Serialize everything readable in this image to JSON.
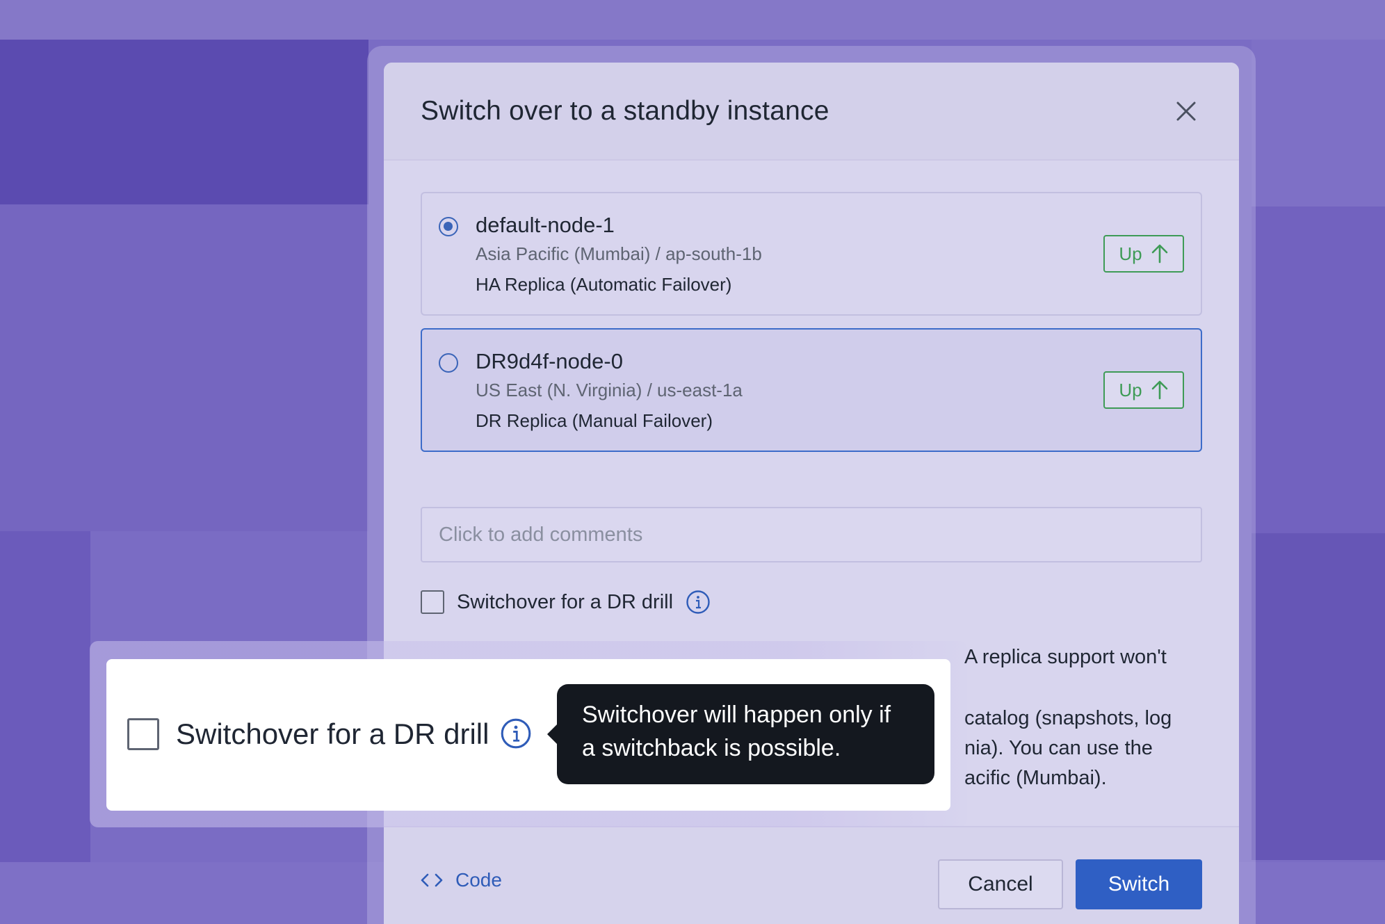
{
  "dialog": {
    "title": "Switch over to a standby instance",
    "close_icon": "close-icon"
  },
  "nodes": [
    {
      "name": "default-node-1",
      "region": "Asia Pacific (Mumbai) / ap-south-1b",
      "role": "HA Replica  (Automatic Failover)",
      "status": "Up",
      "selected": true
    },
    {
      "name": "DR9d4f-node-0",
      "region": "US East (N. Virginia) / us-east-1a",
      "role": "DR Replica (Manual Failover)",
      "status": "Up",
      "selected": false
    }
  ],
  "comments": {
    "placeholder": "Click to add comments",
    "value": ""
  },
  "drill": {
    "label": "Switchover for a DR drill",
    "checked": false
  },
  "description": {
    "line1": "A replica support won't",
    "line2": "catalog (snapshots, log",
    "line3": "nia). You can use the",
    "line4": "acific (Mumbai)."
  },
  "footer": {
    "code_label": "Code",
    "cancel_label": "Cancel",
    "switch_label": "Switch"
  },
  "callout": {
    "label": "Switchover for a DR drill",
    "tooltip_line1": "Switchover will happen only if",
    "tooltip_line2": "a switchback is possible."
  },
  "colors": {
    "primary": "#2f5fc4",
    "status_up": "#3e9b56",
    "background": "#7a6cc4",
    "tooltip_bg": "#14181f"
  }
}
